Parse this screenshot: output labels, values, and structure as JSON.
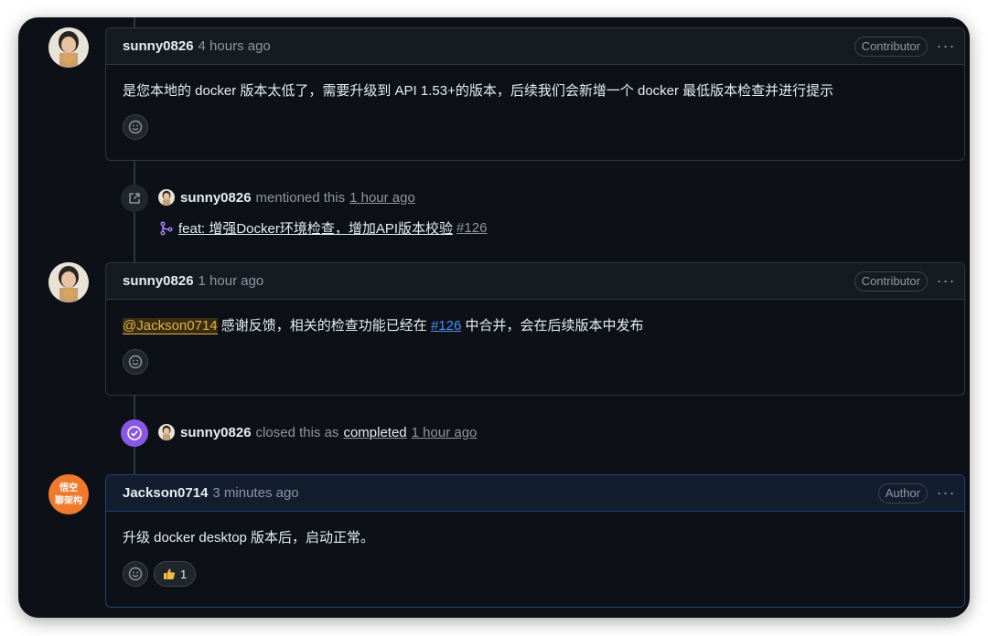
{
  "comments": [
    {
      "user": "sunny0826",
      "time": "4 hours ago",
      "badge": "Contributor",
      "more": "···",
      "text": "是您本地的 docker 版本太低了，需要升级到 API 1.53+的版本，后续我们会新增一个 docker 最低版本检查并进行提示"
    },
    {
      "user": "sunny0826",
      "time": "1 hour ago",
      "badge": "Contributor",
      "more": "···",
      "mention": "@Jackson0714",
      "text_before_ref": " 感谢反馈，相关的检查功能已经在 ",
      "ref": "#126",
      "text_after_ref": " 中合并，会在后续版本中发布"
    },
    {
      "user": "Jackson0714",
      "time": "3 minutes ago",
      "badge": "Author",
      "more": "···",
      "text": "升级 docker desktop 版本后，启动正常。",
      "reaction_count": "1",
      "avatar_text_top": "悟空",
      "avatar_text_bottom": "聊架构"
    }
  ],
  "events": {
    "mentioned": {
      "user": "sunny0826",
      "text": "mentioned this",
      "time": "1 hour ago",
      "pr_title": "feat: 增强Docker环境检查，增加API版本校验",
      "pr_number": "#126"
    },
    "closed": {
      "user": "sunny0826",
      "text": "closed this as",
      "status": "completed",
      "time": "1 hour ago"
    }
  },
  "colors": {
    "background": "#0d1117",
    "closed_purple": "#8957e5",
    "mention_yellow": "#e3b341",
    "link_blue": "#4493f8"
  }
}
